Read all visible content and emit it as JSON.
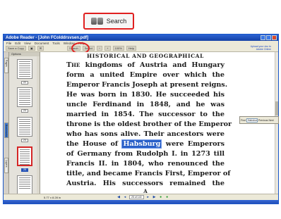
{
  "callout": {
    "label": "Search"
  },
  "window": {
    "title": "Adobe Reader - [John FColddrsvsen.pdf]",
    "menu": [
      "File",
      "Edit",
      "View",
      "Document",
      "Tools",
      "Window",
      "Help"
    ]
  },
  "toolbar": {
    "save_copy": "Save a Copy",
    "search": "Search",
    "select": "Select",
    "zoom": "100%",
    "help": "Help",
    "help_link": "Upload your doc to Adobe Online"
  },
  "nav_tabs": [
    "Pages",
    "Bookmarks",
    "Layers"
  ],
  "thumbnails": {
    "options_label": "Options",
    "page_numbers": [
      "22",
      "23",
      "24",
      "25",
      "26"
    ],
    "selected_index": 3
  },
  "document": {
    "heading": "HISTORICAL AND GEOGRAPHICAL",
    "lines": [
      {
        "pre_sc": "T",
        "sc": "HE",
        "text": " kingdoms of Austria and Hungary"
      },
      {
        "text": "form a united Empire over which the"
      },
      {
        "text": "Emperor Francis Joseph at present reigns."
      },
      {
        "text": "He was born in 1830.  He succeeded his"
      },
      {
        "text": "uncle Ferdinand in 1848, and he was"
      },
      {
        "text": "married in 1854.  The successor to the"
      },
      {
        "text": "throne is the oldest brother of the Emperor"
      },
      {
        "text": "who has sons alive.  Their ancestors were"
      },
      {
        "before": "the House of ",
        "highlight": "Habsburg",
        "after": " were Emperors"
      },
      {
        "text": "of Germany from Rudolph I. in 1273 till"
      },
      {
        "text": "Francis II. in 1804, who renounced the"
      },
      {
        "text": "title, and became Francis First, Emperor of"
      },
      {
        "text": "Austria.   His successors remained the"
      }
    ],
    "page_letter": "A"
  },
  "find": {
    "label": "Find",
    "value": "Habsburg",
    "previous": "Previous",
    "next": "Next"
  },
  "status": {
    "dims": "5.77 x 8.28 in",
    "page_field": "25 of 140"
  }
}
